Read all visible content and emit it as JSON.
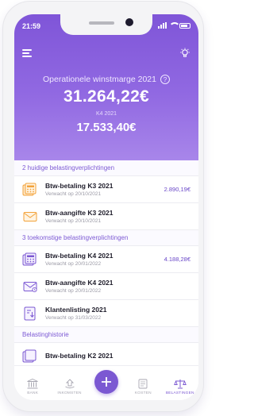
{
  "status_bar": {
    "time": "21:59"
  },
  "hero": {
    "label": "Operationele winstmarge 2021",
    "help": "?",
    "amount": "31.264,22€",
    "sub_label": "K4 2021",
    "sub_amount": "17.533,40€"
  },
  "sections": [
    {
      "header": "2 huidige belastingverplichtingen",
      "rows": [
        {
          "title": "Btw-betaling K3 2021",
          "sub": "Verwacht op 20/10/2021",
          "amount": "2.890,19€",
          "icon": "payment-calculator-icon"
        },
        {
          "title": "Btw-aangifte K3 2021",
          "sub": "Verwacht op 20/10/2021",
          "amount": "",
          "icon": "declaration-envelope-icon"
        }
      ]
    },
    {
      "header": "3 toekomstige belastingverplichtingen",
      "rows": [
        {
          "title": "Btw-betaling K4 2021",
          "sub": "Verwacht op 20/01/2022",
          "amount": "4.188,28€",
          "icon": "payment-calculator-icon"
        },
        {
          "title": "Btw-aangifte K4 2021",
          "sub": "Verwacht op 20/01/2022",
          "amount": "",
          "icon": "declaration-envelope-icon"
        },
        {
          "title": "Klantenlisting 2021",
          "sub": "Verwacht op 31/03/2022",
          "amount": "",
          "icon": "client-listing-document-icon"
        }
      ]
    },
    {
      "header": "Belastinghistorie",
      "rows": [
        {
          "title": "Btw-betaling K2 2021",
          "sub": "",
          "amount": "",
          "icon": "payment-calculator-icon"
        }
      ]
    }
  ],
  "tabbar": {
    "items": [
      {
        "label": "BANK",
        "icon": "bank-icon",
        "active": false
      },
      {
        "label": "INKOMSTEN",
        "icon": "income-icon",
        "active": false
      },
      {
        "label": "",
        "icon": "plus-icon",
        "active": false
      },
      {
        "label": "KOSTEN",
        "icon": "costs-icon",
        "active": false
      },
      {
        "label": "BELASTINGEN",
        "icon": "scales-icon",
        "active": true
      }
    ]
  },
  "colors": {
    "accent": "#7b58d2",
    "amount": "#6a48c8",
    "icon_orange": "#f3a23a"
  }
}
